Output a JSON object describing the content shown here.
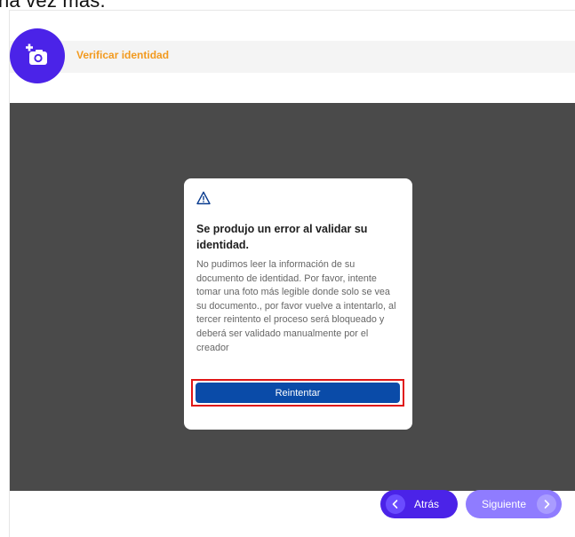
{
  "cropped_top_text": "na vez más.",
  "header": {
    "title": "Verificar identidad",
    "avatar_icon": "add-photo-icon",
    "accent_color": "#f29a1f",
    "brand_color": "#4b23e8"
  },
  "modal": {
    "icon": "warning-icon",
    "title": "Se produjo un error al validar su identidad.",
    "body": "No pudimos leer la información de su documento de identidad. Por favor, intente tomar una foto más legible donde solo se vea su documento., por favor vuelve a intentarlo, al tercer reintento el proceso será bloqueado y deberá ser validado manualmente por el creador",
    "retry_label": "Reintentar"
  },
  "footer": {
    "back_label": "Atrás",
    "next_label": "Siguiente"
  }
}
